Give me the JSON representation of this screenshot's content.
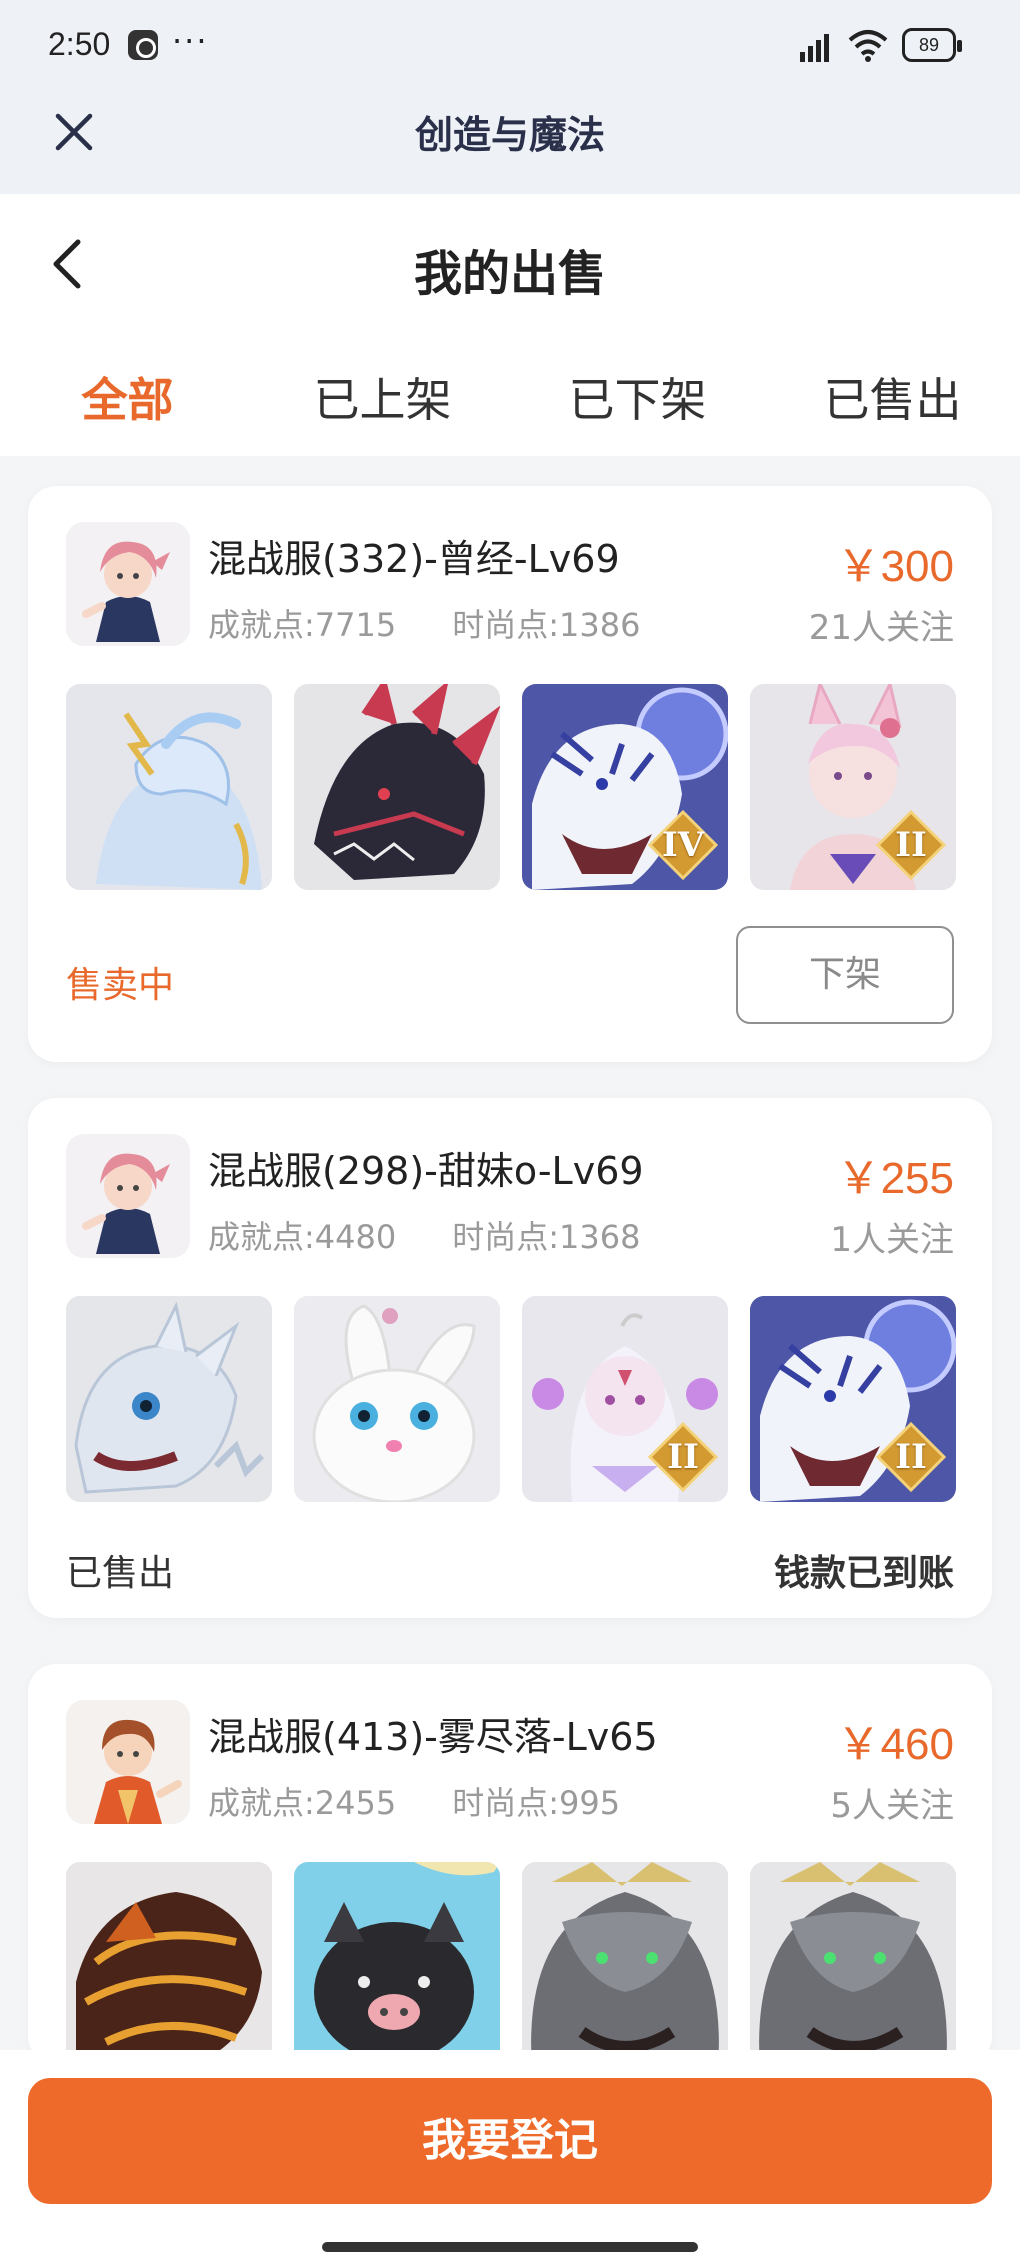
{
  "status_bar": {
    "time": "2:50",
    "more": "···",
    "battery": "89"
  },
  "app_bar": {
    "title": "创造与魔法"
  },
  "header": {
    "title": "我的出售"
  },
  "tabs": [
    {
      "label": "全部",
      "active": true
    },
    {
      "label": "已上架",
      "active": false
    },
    {
      "label": "已下架",
      "active": false
    },
    {
      "label": "已售出",
      "active": false
    }
  ],
  "listings": [
    {
      "name": "混战服(332)-曾经-Lv69",
      "achievement": "成就点:7715",
      "fashion": "时尚点:1386",
      "price": "￥300",
      "followers": "21人关注",
      "status": "售卖中",
      "action": "下架",
      "pets": [
        {
          "icon": "ice-qilin-icon"
        },
        {
          "icon": "dark-dragon-icon"
        },
        {
          "icon": "white-tiger-icon",
          "tier": "IV"
        },
        {
          "icon": "fox-spirit-icon",
          "tier": "II"
        }
      ]
    },
    {
      "name": "混战服(298)-甜妹o-Lv69",
      "achievement": "成就点:4480",
      "fashion": "时尚点:1368",
      "price": "￥255",
      "followers": "1人关注",
      "status": "已售出",
      "result": "钱款已到账",
      "pets": [
        {
          "icon": "ice-dragon-icon"
        },
        {
          "icon": "white-rabbit-icon"
        },
        {
          "icon": "spirit-girl-icon",
          "tier": "II"
        },
        {
          "icon": "white-tiger-icon",
          "tier": "II"
        }
      ]
    },
    {
      "name": "混战服(413)-雾尽落-Lv65",
      "achievement": "成就点:2455",
      "fashion": "时尚点:995",
      "price": "￥460",
      "followers": "5人关注",
      "pets": [
        {
          "icon": "fire-dragon-icon"
        },
        {
          "icon": "black-pig-icon"
        },
        {
          "icon": "grey-wolf-icon"
        },
        {
          "icon": "grey-wolf-icon"
        }
      ]
    }
  ],
  "footer": {
    "register_label": "我要登记"
  },
  "colors": {
    "accent": "#e8692b",
    "button": "#ee6a2a",
    "muted": "#9a9a9a"
  }
}
